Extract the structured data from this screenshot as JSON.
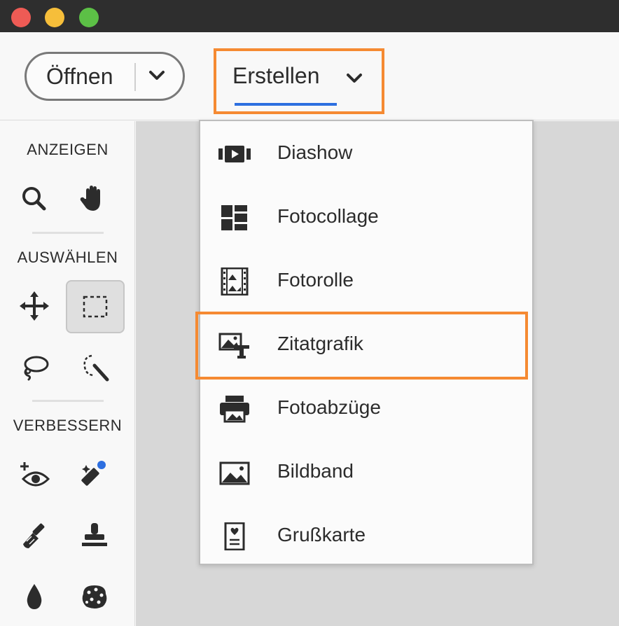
{
  "window": {
    "controls": [
      "close",
      "minimize",
      "zoom"
    ]
  },
  "toolbar": {
    "open_label": "Öffnen",
    "create_label": "Erstellen"
  },
  "sidebar": {
    "sections": [
      {
        "title": "ANZEIGEN",
        "tools": [
          "zoom-icon",
          "hand-icon"
        ]
      },
      {
        "title": "AUSWÄHLEN",
        "tools": [
          "move-icon",
          "rectangle-marquee-icon",
          "lasso-icon",
          "magic-wand-icon"
        ]
      },
      {
        "title": "VERBESSERN",
        "tools": [
          "red-eye-icon",
          "healing-brush-icon",
          "brush-icon",
          "stamp-icon",
          "blur-icon",
          "sponge-icon"
        ]
      }
    ],
    "active_tool": "rectangle-marquee-icon"
  },
  "create_menu": {
    "items": [
      {
        "label": "Diashow",
        "icon": "slideshow-icon"
      },
      {
        "label": "Fotocollage",
        "icon": "collage-icon"
      },
      {
        "label": "Fotorolle",
        "icon": "filmstrip-icon"
      },
      {
        "label": "Zitatgrafik",
        "icon": "quote-graphic-icon"
      },
      {
        "label": "Fotoabzüge",
        "icon": "printer-icon"
      },
      {
        "label": "Bildband",
        "icon": "photobook-icon"
      },
      {
        "label": "Grußkarte",
        "icon": "greeting-card-icon"
      }
    ],
    "highlighted_item": "Zitatgrafik"
  },
  "colors": {
    "highlight": "#f58a32",
    "accent_underline": "#2d6fe0",
    "notification_dot": "#2d6fe0"
  }
}
